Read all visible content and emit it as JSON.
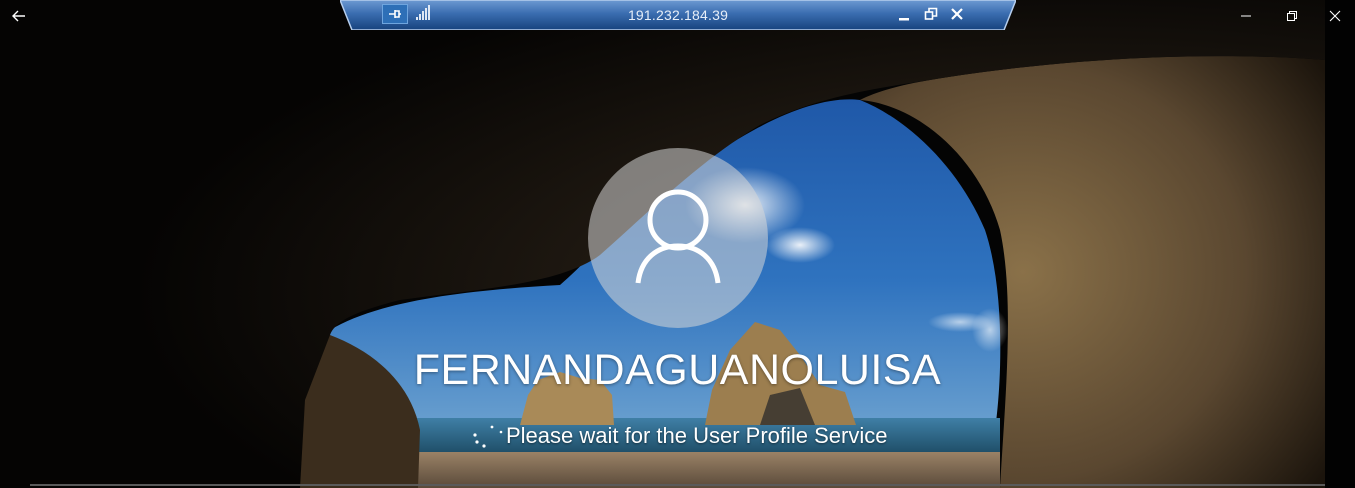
{
  "window": {
    "back_icon": "back-arrow-icon",
    "controls": [
      "minimize-icon",
      "maximize-icon",
      "close-icon"
    ]
  },
  "rdp_bar": {
    "title": "191.232.184.39",
    "pin_icon": "pin-icon",
    "signal_icon": "connection-signal-icon",
    "controls": [
      "minimize-icon",
      "restore-icon",
      "close-icon"
    ],
    "colors": {
      "bar_top": "#5a8fd0",
      "bar_bottom": "#1d4f94",
      "border": "#a9c6ea"
    }
  },
  "login": {
    "avatar_icon": "user-icon",
    "username": "FERNANDAGUANOLUISA",
    "status": "Please wait for the User Profile Service",
    "spinner_icon": "loading-spinner-icon"
  }
}
